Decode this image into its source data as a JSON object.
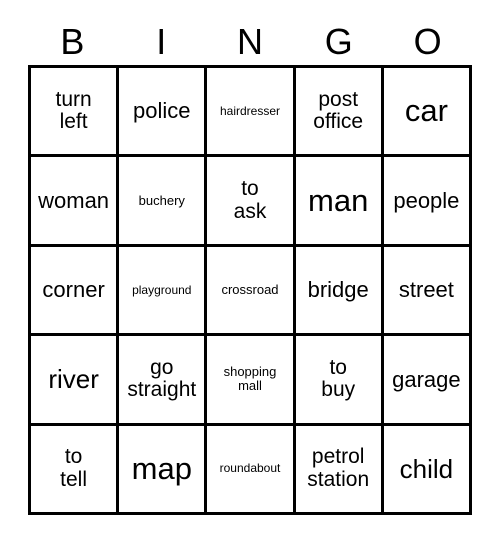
{
  "card": {
    "headers": [
      "B",
      "I",
      "N",
      "G",
      "O"
    ],
    "rows": [
      [
        {
          "text": "turn\nleft",
          "size": "two"
        },
        {
          "text": "police",
          "size": "md"
        },
        {
          "text": "hairdresser",
          "size": "xs"
        },
        {
          "text": "post\noffice",
          "size": "two"
        },
        {
          "text": "car",
          "size": "xl"
        }
      ],
      [
        {
          "text": "woman",
          "size": "md"
        },
        {
          "text": "buchery",
          "size": "sm"
        },
        {
          "text": "to\nask",
          "size": "two"
        },
        {
          "text": "man",
          "size": "xl"
        },
        {
          "text": "people",
          "size": "md"
        }
      ],
      [
        {
          "text": "corner",
          "size": "md"
        },
        {
          "text": "playground",
          "size": "xs"
        },
        {
          "text": "crossroad",
          "size": "sm"
        },
        {
          "text": "bridge",
          "size": "md"
        },
        {
          "text": "street",
          "size": "md"
        }
      ],
      [
        {
          "text": "river",
          "size": "lg"
        },
        {
          "text": "go\nstraight",
          "size": "two"
        },
        {
          "text": "shopping\nmall",
          "size": "sm"
        },
        {
          "text": "to\nbuy",
          "size": "two"
        },
        {
          "text": "garage",
          "size": "md"
        }
      ],
      [
        {
          "text": "to\ntell",
          "size": "two"
        },
        {
          "text": "map",
          "size": "xl"
        },
        {
          "text": "roundabout",
          "size": "xs"
        },
        {
          "text": "petrol\nstation",
          "size": "two"
        },
        {
          "text": "child",
          "size": "lg"
        }
      ]
    ]
  }
}
